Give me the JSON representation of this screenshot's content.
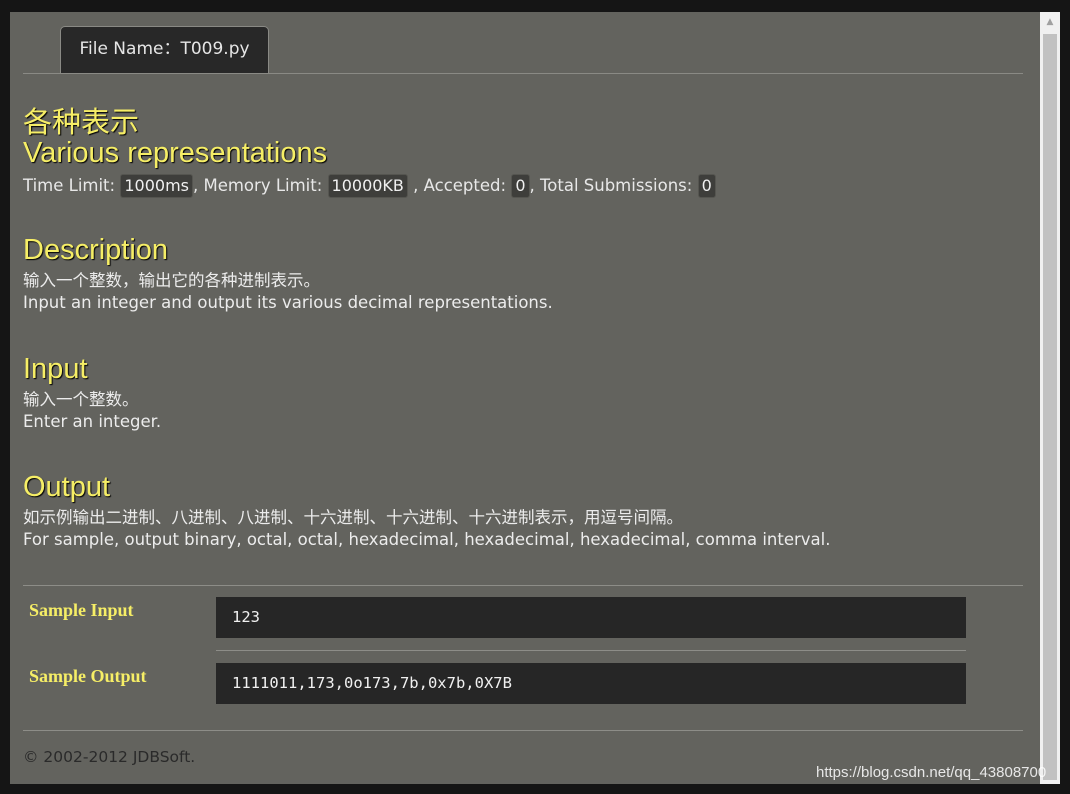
{
  "tab": {
    "label": "File Name：T009.py"
  },
  "problem": {
    "title_cn": "各种表示",
    "title_en": "Various representations",
    "time_limit_label": "Time Limit: ",
    "time_limit_value": "1000ms",
    "memory_limit_label": ", Memory Limit: ",
    "memory_limit_value": "10000KB",
    "accepted_label": " , Accepted: ",
    "accepted_value": "0",
    "submissions_label": ", Total Submissions: ",
    "submissions_value": "0"
  },
  "description": {
    "heading": "Description",
    "line_cn": "输入一个整数，输出它的各种进制表示。",
    "line_en": "Input an integer and output its various decimal representations."
  },
  "input": {
    "heading": "Input",
    "line_cn": "输入一个整数。",
    "line_en": "Enter an integer."
  },
  "output": {
    "heading": "Output",
    "line_cn": "如示例输出二进制、八进制、八进制、十六进制、十六进制、十六进制表示，用逗号间隔。",
    "line_en": "For sample, output binary, octal, octal, hexadecimal, hexadecimal, hexadecimal, comma interval."
  },
  "samples": {
    "input_label": "Sample Input",
    "input_value": "123",
    "output_label": "Sample Output",
    "output_value": "1111011,173,0o173,7b,0x7b,0X7B"
  },
  "footer": {
    "text": "© 2002-2012  JDBSoft."
  },
  "watermark": {
    "text": "https://blog.csdn.net/qq_43808700"
  },
  "colors": {
    "page_bg": "#63635e",
    "heading": "#f6ee66",
    "code_bg": "#262626",
    "tab_bg": "#282828"
  }
}
